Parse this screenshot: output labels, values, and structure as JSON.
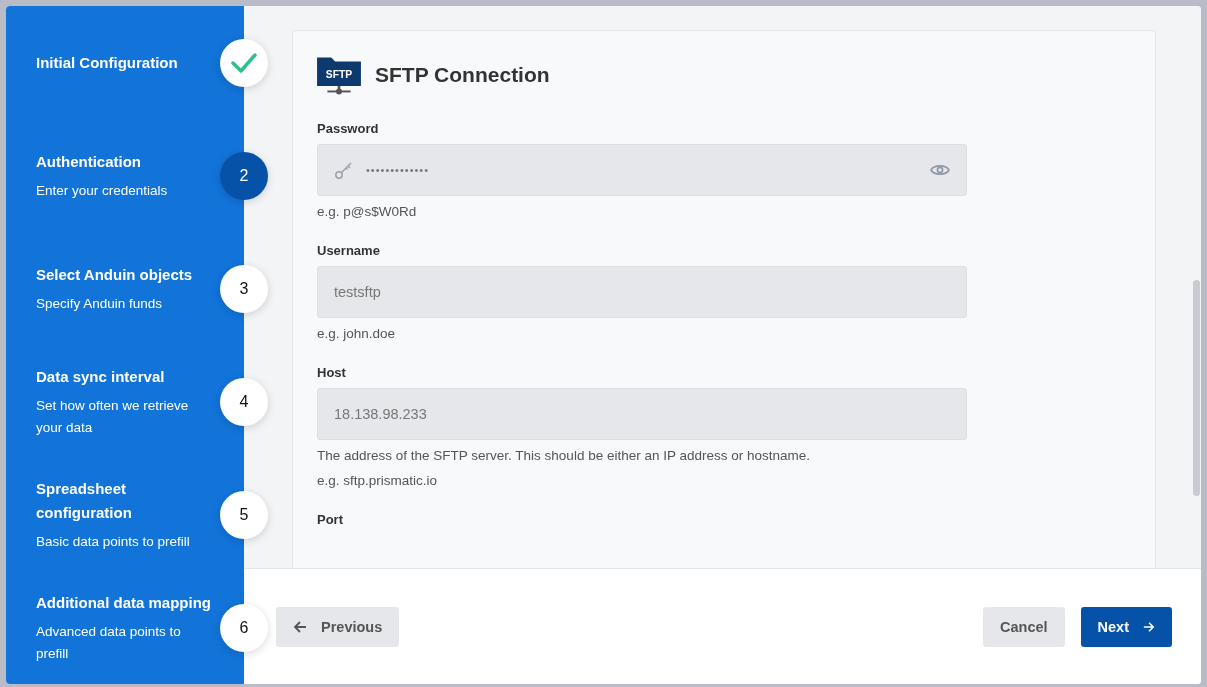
{
  "steps": [
    {
      "title": "Initial Configuration",
      "kind": "done"
    },
    {
      "title": "Authentication",
      "description": "Enter your credentials",
      "number": "2",
      "kind": "current"
    },
    {
      "title": "Select Anduin objects",
      "description": "Specify Anduin funds",
      "number": "3",
      "kind": "pending"
    },
    {
      "title": "Data sync interval",
      "description": "Set how often we retrieve your data",
      "number": "4",
      "kind": "pending"
    },
    {
      "title": "Spreadsheet configuration",
      "description": "Basic data points to prefill",
      "number": "5",
      "kind": "pending"
    },
    {
      "title": "Additional data mapping",
      "description": "Advanced data points to prefill",
      "number": "6",
      "kind": "pending"
    }
  ],
  "section": {
    "icon_label": "SFTP",
    "title": "SFTP Connection"
  },
  "fields": [
    {
      "label": "Password",
      "kind": "password",
      "value": "•••••••••••••",
      "hint": "e.g. p@s$W0Rd"
    },
    {
      "label": "Username",
      "kind": "text",
      "value": "testsftp",
      "hint": "e.g. john.doe"
    },
    {
      "label": "Host",
      "kind": "text",
      "value": "18.138.98.233",
      "help": "The address of the SFTP server. This should be either an IP address or hostname.",
      "hint": "e.g. sftp.prismatic.io"
    },
    {
      "label": "Port",
      "kind": "label_only"
    }
  ],
  "footer": {
    "previous": "Previous",
    "cancel": "Cancel",
    "next": "Next"
  }
}
